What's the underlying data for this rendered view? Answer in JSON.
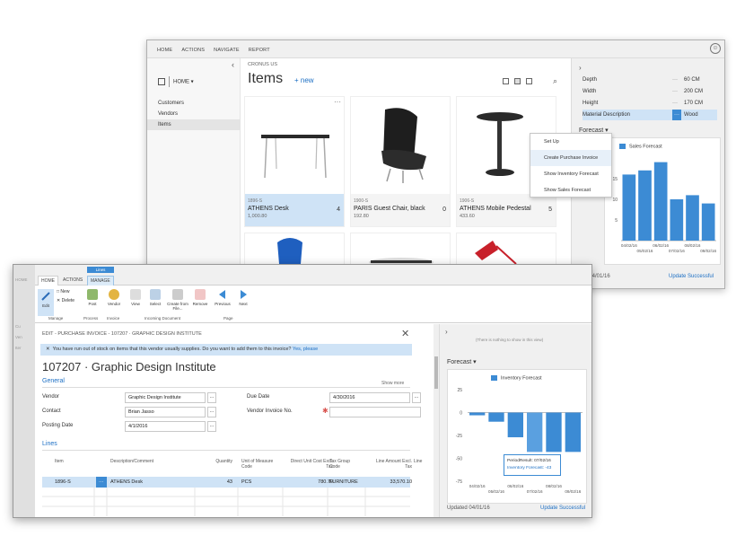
{
  "back_window": {
    "menu": [
      "HOME",
      "ACTIONS",
      "NAVIGATE",
      "REPORT"
    ],
    "nav": {
      "home_label": "HOME",
      "items": [
        "Customers",
        "Vendors",
        "Items"
      ]
    },
    "company": "CRONUS US",
    "title": "Items",
    "new_label": "+ new",
    "cards": [
      {
        "num": "1896-S",
        "name": "ATHENS Desk",
        "price": "1,000.80",
        "count": "4"
      },
      {
        "num": "1900-S",
        "name": "PARIS Guest Chair, black",
        "price": "192.80",
        "count": "0"
      },
      {
        "num": "1906-S",
        "name": "ATHENS Mobile Pedestal",
        "price": "433.60",
        "count": "5"
      }
    ],
    "context_menu": [
      "Set Up",
      "Create Purchase Invoice",
      "Show Inventory Forecast",
      "Show Sales Forecast"
    ],
    "attributes": [
      {
        "key": "Depth",
        "value": "60 CM"
      },
      {
        "key": "Width",
        "value": "200 CM"
      },
      {
        "key": "Height",
        "value": "170 CM"
      },
      {
        "key": "Material Description",
        "value": "Wood"
      }
    ],
    "forecast_title": "Forecast",
    "updated": "Updated 04/01/16",
    "updated_short": "ated 04/01/16",
    "update_link": "Update Successful",
    "accent": "#3c8bd4"
  },
  "front_window": {
    "ghost_nav": [
      "HOME",
      "Cu",
      "Ven",
      "Iter"
    ],
    "lines_tab": "Lines",
    "tabs": [
      "HOME",
      "ACTIONS",
      "MANAGE"
    ],
    "ribbon": {
      "edit": "Edit",
      "new": "New",
      "delete": "Delete",
      "post": "Post",
      "vendor": "Vendor",
      "view": "View",
      "select": "Select",
      "create_from_file": "Create from File...",
      "remove": "Remove",
      "previous": "Previous",
      "next": "Next",
      "groups": [
        "Manage",
        "Process",
        "Invoice",
        "Incoming Document",
        "Page"
      ]
    },
    "breadcrumb": "EDIT - PURCHASE INVOICE - 107207 · GRAPHIC DESIGN INSTITUTE",
    "notification": "You have run out of stock on items that this vendor usually supplies. Do you want to add them to this invoice?",
    "notification_link": "Yes, please",
    "doc_title": "107207 · Graphic Design Institute",
    "general_label": "General",
    "show_more": "Show more",
    "fields": {
      "vendor_label": "Vendor",
      "vendor_value": "Graphic Design Institute",
      "contact_label": "Contact",
      "contact_value": "Brian Jasso",
      "posting_date_label": "Posting Date",
      "posting_date_value": "4/1/2016",
      "due_date_label": "Due Date",
      "due_date_value": "4/30/2016",
      "vendor_invoice_label": "Vendor Invoice No.",
      "vendor_invoice_value": ""
    },
    "lines_label": "Lines",
    "lines_headers": [
      "Item",
      "Description/Comment",
      "Quantity",
      "Unit of Measure Code",
      "Direct Unit Cost Excl. Tax",
      "Tax Group Code",
      "Line Amount Excl. Tax",
      "Line"
    ],
    "lines_rows": [
      [
        "1896-S",
        "ATHENS Desk",
        "43",
        "PCS",
        "780.70",
        "FURNITURE",
        "33,570.10"
      ]
    ],
    "factbox_hint": "(There is nothing to show in this view)",
    "forecast_title": "Forecast",
    "tooltip_line1": "PeriodResult: 07/02/16",
    "tooltip_line2": "Inventory Forecast: -43",
    "updated": "Updated 04/01/16",
    "update_link": "Update Successful"
  },
  "chart_data": [
    {
      "type": "bar",
      "title": "",
      "series": [
        {
          "name": "Sales Forecast",
          "values": [
            16,
            17,
            19,
            10,
            11,
            9
          ]
        }
      ],
      "categories": [
        "04/02/16",
        "05/02/16",
        "06/02/16",
        "07/02/16",
        "08/02/16",
        "09/02/16"
      ],
      "yticks": [
        5,
        10,
        15
      ],
      "ylim": [
        0,
        20
      ],
      "legend": "top"
    },
    {
      "type": "bar",
      "title": "",
      "series": [
        {
          "name": "Inventory Forecast",
          "values": [
            -3,
            -10,
            -27,
            -43,
            -43,
            -43
          ]
        }
      ],
      "categories": [
        "04/02/16",
        "05/02/16",
        "06/02/16",
        "07/02/16",
        "08/02/16",
        "09/02/16"
      ],
      "yticks": [
        25,
        0,
        -25,
        -50,
        -75
      ],
      "ylim": [
        -75,
        25
      ],
      "legend": "top"
    }
  ]
}
